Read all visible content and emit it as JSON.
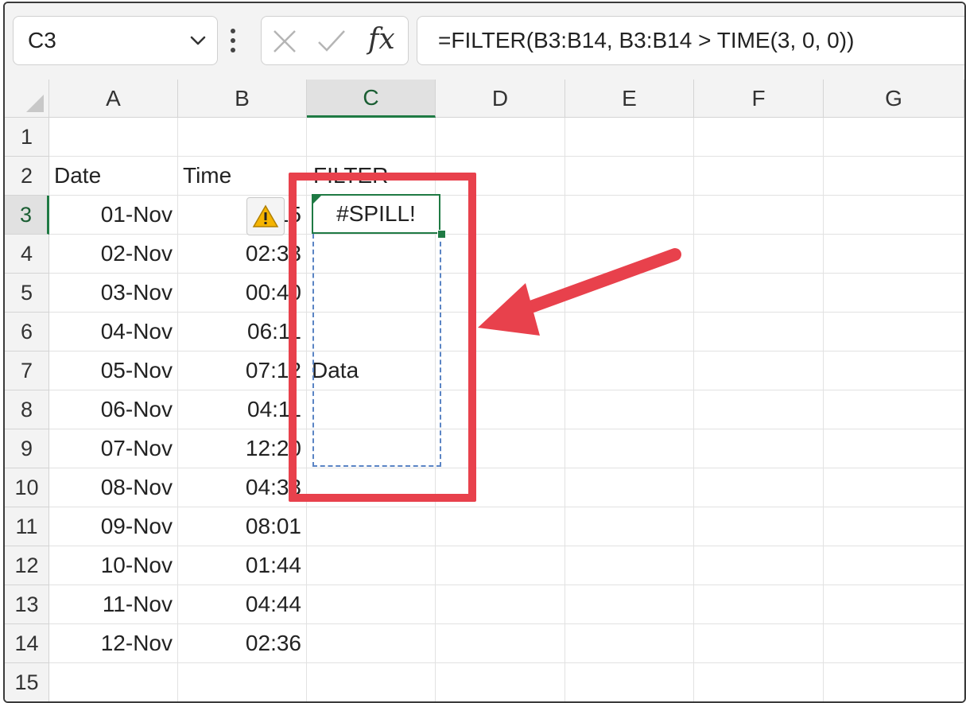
{
  "formula_bar": {
    "name_box": "C3",
    "fx_label": "fx",
    "formula": "=FILTER(B3:B14, B3:B14 > TIME(3, 0, 0))"
  },
  "columns": [
    "A",
    "B",
    "C",
    "D",
    "E",
    "F",
    "G"
  ],
  "rows": [
    "1",
    "2",
    "3",
    "4",
    "5",
    "6",
    "7",
    "8",
    "9",
    "10",
    "11",
    "12",
    "13",
    "14",
    "15"
  ],
  "sheet": {
    "headers": {
      "date": "Date",
      "time": "Time",
      "filter": "FILTER"
    },
    "data": [
      {
        "date": "01-Nov",
        "time": "01:15"
      },
      {
        "date": "02-Nov",
        "time": "02:33"
      },
      {
        "date": "03-Nov",
        "time": "00:40"
      },
      {
        "date": "04-Nov",
        "time": "06:11"
      },
      {
        "date": "05-Nov",
        "time": "07:12"
      },
      {
        "date": "06-Nov",
        "time": "04:11"
      },
      {
        "date": "07-Nov",
        "time": "12:20"
      },
      {
        "date": "08-Nov",
        "time": "04:33"
      },
      {
        "date": "09-Nov",
        "time": "08:01"
      },
      {
        "date": "10-Nov",
        "time": "01:44"
      },
      {
        "date": "11-Nov",
        "time": "04:44"
      },
      {
        "date": "12-Nov",
        "time": "02:36"
      }
    ],
    "spill_error": "#SPILL!",
    "blocking_value": "Data"
  },
  "colors": {
    "accent_green": "#1f7a44",
    "highlight_red": "#e8414c",
    "spill_dash": "#5a84c4",
    "warning_yellow": "#f5b400"
  }
}
